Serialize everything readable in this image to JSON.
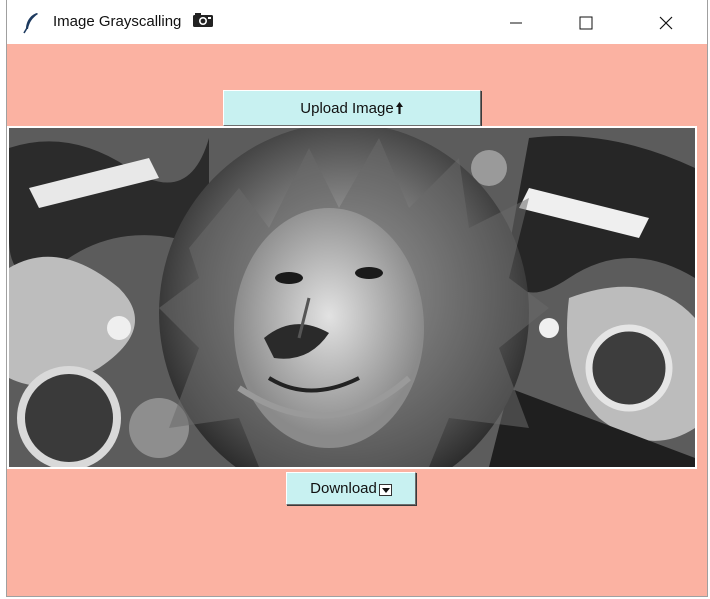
{
  "window": {
    "title": "Image Grayscalling",
    "title_icons": [
      "feather-icon",
      "camera-icon"
    ],
    "controls": [
      "minimize-icon",
      "maximize-icon",
      "close-icon"
    ]
  },
  "buttons": {
    "upload_label": "Upload Image",
    "upload_icon": "upload-arrow-icon",
    "download_label": "Download",
    "download_icon": "download-dropdown-icon"
  },
  "colors": {
    "background": "#fbb2a2",
    "button": "#c8f1f1"
  },
  "image": {
    "content": "grayscale-lion-artwork"
  }
}
